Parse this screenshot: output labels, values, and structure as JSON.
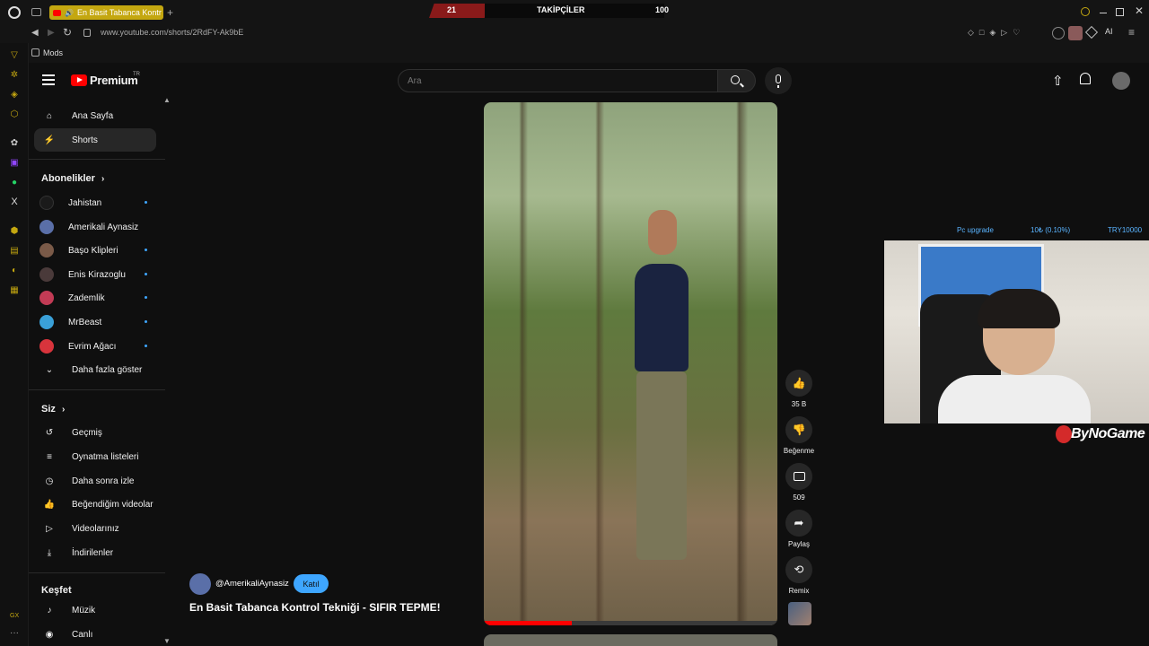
{
  "browser": {
    "tab_title": "En Basit Tabanca Kontr",
    "url": "www.youtube.com/shorts/2RdFY-Ak9bE",
    "bookmark_mods": "Mods",
    "ai_label": "AI",
    "gx_label": "GX"
  },
  "overlay_stream": {
    "left_count": "21",
    "center_label": "TAKİPÇİLER",
    "right_count": "100",
    "upgrade_label": "Pc upgrade",
    "upgrade_progress": "10₺ (0.10%)",
    "upgrade_goal": "TRY10000",
    "brand": "ByNoGame"
  },
  "youtube": {
    "logo_text": "Premium",
    "logo_badge": "TR",
    "search_placeholder": "Ara",
    "nav": [
      {
        "label": "Ana Sayfa",
        "icon": "home-icon"
      },
      {
        "label": "Shorts",
        "icon": "shorts-icon"
      }
    ],
    "subscriptions_title": "Abonelikler",
    "subscriptions": [
      {
        "label": "Jahistan",
        "color": "#1a1a1a",
        "dot": true
      },
      {
        "label": "Amerikali Aynasiz",
        "color": "#5a6fa8",
        "dot": false
      },
      {
        "label": "Başo Klipleri",
        "color": "#7a5a48",
        "dot": true
      },
      {
        "label": "Enis Kirazoglu",
        "color": "#4a3a3a",
        "dot": true
      },
      {
        "label": "Zademlik",
        "color": "#c23b55",
        "dot": true
      },
      {
        "label": "MrBeast",
        "color": "#3aa0d8",
        "dot": true
      },
      {
        "label": "Evrim Ağacı",
        "color": "#d8343c",
        "dot": true
      }
    ],
    "show_more": "Daha fazla göster",
    "you_title": "Siz",
    "you_items": [
      {
        "label": "Geçmiş",
        "icon": "history-icon"
      },
      {
        "label": "Oynatma listeleri",
        "icon": "playlist-icon"
      },
      {
        "label": "Daha sonra izle",
        "icon": "clock-icon"
      },
      {
        "label": "Beğendiğim videolar",
        "icon": "thumb-up-icon"
      },
      {
        "label": "Videolarınız",
        "icon": "video-icon"
      },
      {
        "label": "İndirilenler",
        "icon": "download-icon"
      }
    ],
    "explore_title": "Keşfet",
    "explore_items": [
      {
        "label": "Müzik",
        "icon": "music-icon"
      },
      {
        "label": "Canlı",
        "icon": "live-icon"
      }
    ],
    "short": {
      "channel": "@AmerikaliAynasiz",
      "join_label": "Katıl",
      "title": "En Basit Tabanca Kontrol Tekniği - SIFIR TEPME!",
      "progress": 0.3
    },
    "actions": {
      "like_count": "35 B",
      "dislike_label": "Beğenme",
      "comment_count": "509",
      "share_label": "Paylaş",
      "remix_label": "Remix"
    }
  }
}
